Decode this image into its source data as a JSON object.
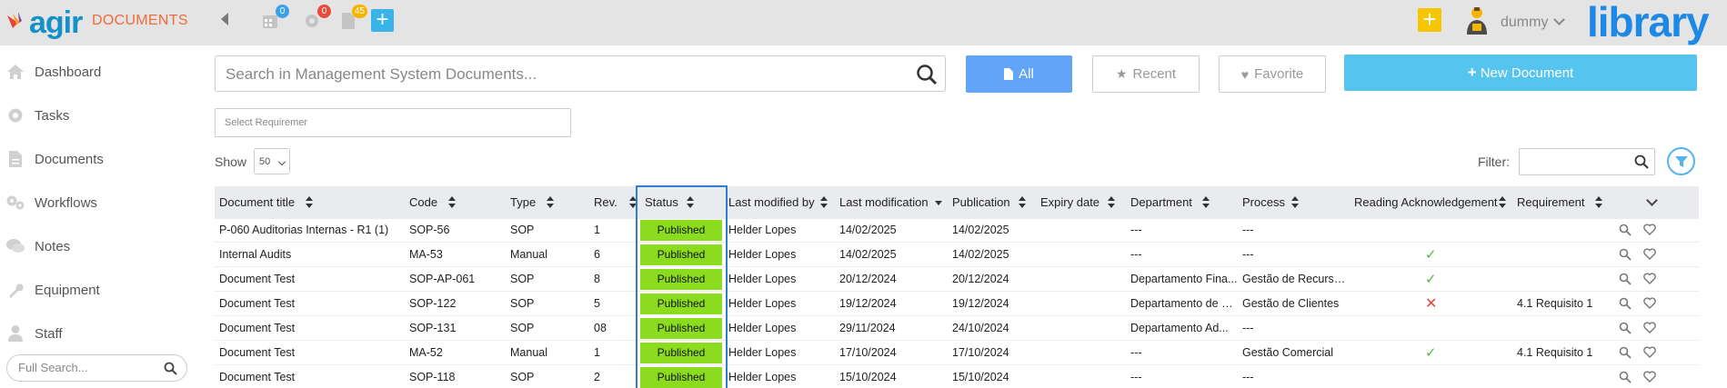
{
  "header": {
    "logo_text": "agir",
    "module_title": "DOCUMENTS",
    "badges": {
      "calendar": "0",
      "settings": "0",
      "documents": "45"
    },
    "username": "dummy",
    "library_text": "library",
    "icons": [
      "calendar-icon",
      "gear-icon",
      "document-icon",
      "plus-icon",
      "chevron-left-icon"
    ]
  },
  "sidebar": {
    "items": [
      {
        "label": "Dashboard",
        "icon": "home-icon"
      },
      {
        "label": "Tasks",
        "icon": "gear-icon"
      },
      {
        "label": "Documents",
        "icon": "document-icon"
      },
      {
        "label": "Workflows",
        "icon": "workflow-icon"
      },
      {
        "label": "Notes",
        "icon": "chat-icon"
      },
      {
        "label": "Equipment",
        "icon": "wrench-icon"
      },
      {
        "label": "Staff",
        "icon": "user-icon"
      }
    ],
    "full_search_placeholder": "Full Search..."
  },
  "toolbar": {
    "search_placeholder": "Search in Management System Documents...",
    "all_label": "All",
    "recent_label": "Recent",
    "favorite_label": "Favorite",
    "new_document_label": "New Document",
    "requirement_placeholder": "Select Requiremer",
    "show_label": "Show",
    "show_value": "50",
    "filter_label": "Filter:",
    "filter_value": ""
  },
  "colors": {
    "accent_blue": "#62a4f7",
    "new_button": "#55c5f0",
    "published": "#8bdc1e",
    "module_orange": "#ef6b3a",
    "highlight_border": "#2f7ecf"
  },
  "table": {
    "columns": [
      "Document title",
      "Code",
      "Type",
      "Rev.",
      "Status",
      "Last modified by",
      "Last modification",
      "Publication",
      "Expiry date",
      "Department",
      "Process",
      "Reading Acknowledgement",
      "Requirement"
    ],
    "rows": [
      {
        "title": "P-060 Auditorias Internas - R1 (1)",
        "code": "SOP-56",
        "type": "SOP",
        "rev": "1",
        "status": "Published",
        "modified_by": "Helder Lopes",
        "last_mod": "14/02/2025",
        "publication": "14/02/2025",
        "expiry": "",
        "department": "---",
        "process": "---",
        "ack": "",
        "requirement": ""
      },
      {
        "title": "Internal Audits",
        "code": "MA-53",
        "type": "Manual",
        "rev": "6",
        "status": "Published",
        "modified_by": "Helder Lopes",
        "last_mod": "14/02/2025",
        "publication": "14/02/2025",
        "expiry": "",
        "department": "---",
        "process": "---",
        "ack": "✓",
        "requirement": ""
      },
      {
        "title": "Document Test",
        "code": "SOP-AP-061",
        "type": "SOP",
        "rev": "8",
        "status": "Published",
        "modified_by": "Helder Lopes",
        "last_mod": "20/12/2024",
        "publication": "20/12/2024",
        "expiry": "",
        "department": "Departamento Fina...",
        "process": "Gestão de Recursos...",
        "ack": "✓",
        "requirement": ""
      },
      {
        "title": "Document Test",
        "code": "SOP-122",
        "type": "SOP",
        "rev": "5",
        "status": "Published",
        "modified_by": "Helder Lopes",
        "last_mod": "19/12/2024",
        "publication": "19/12/2024",
        "expiry": "",
        "department": "Departamento de RH",
        "process": "Gestão de Clientes",
        "ack": "✕",
        "requirement": "4.1 Requisito 1"
      },
      {
        "title": "Document Test",
        "code": "SOP-131",
        "type": "SOP",
        "rev": "08",
        "status": "Published",
        "modified_by": "Helder Lopes",
        "last_mod": "29/11/2024",
        "publication": "24/10/2024",
        "expiry": "",
        "department": "Departamento Ad...",
        "process": "---",
        "ack": "",
        "requirement": ""
      },
      {
        "title": "Document Test",
        "code": "MA-52",
        "type": "Manual",
        "rev": "1",
        "status": "Published",
        "modified_by": "Helder Lopes",
        "last_mod": "17/10/2024",
        "publication": "17/10/2024",
        "expiry": "",
        "department": "---",
        "process": "Gestão Comercial",
        "ack": "✓",
        "requirement": "4.1 Requisito 1"
      },
      {
        "title": "Document Test",
        "code": "SOP-118",
        "type": "SOP",
        "rev": "2",
        "status": "Published",
        "modified_by": "Helder Lopes",
        "last_mod": "15/10/2024",
        "publication": "15/10/2024",
        "expiry": "",
        "department": "---",
        "process": "---",
        "ack": "",
        "requirement": ""
      }
    ]
  }
}
